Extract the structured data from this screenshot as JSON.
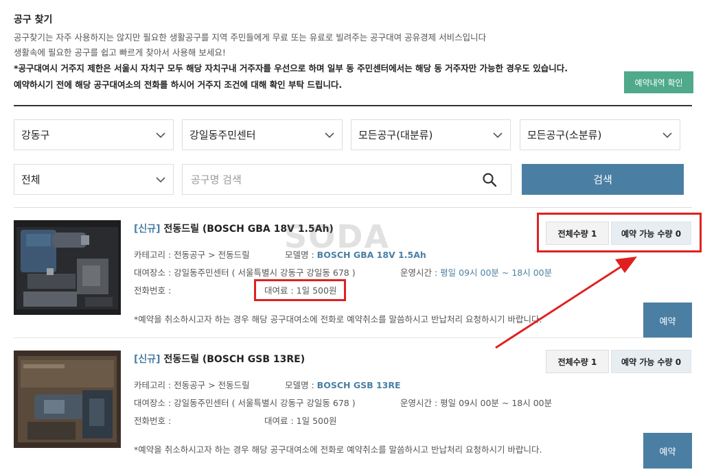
{
  "header": {
    "title": "공구 찾기",
    "desc1": "공구찾기는 자주 사용하지는 않지만 필요한 생활공구를 지역 주민들에게 무료 또는 유료로 빌려주는 공구대여 공유경제 서비스입니다",
    "desc2": "생활속에 필요한 공구를 쉽고 빠르게 찾아서 사용해 보세요!",
    "notice1": "*공구대여시 거주지 제한은 서울시 자치구 모두 해당 자치구내 거주자를 우선으로 하며 일부 동 주민센터에서는 해당 동 거주자만 가능한 경우도 있습니다.",
    "notice2": "예약하시기 전에 해당 공구대여소의 전화를 하시어 거주지 조건에 대해 확인 부탁 드립니다.",
    "reserve_history_label": "예약내역 확인"
  },
  "filters": {
    "district": "강동구",
    "center": "강일동주민센터",
    "category_major": "모든공구(대분류)",
    "category_minor": "모든공구(소분류)",
    "scope": "전체",
    "search_placeholder": "공구명 검색",
    "search_label": "검색"
  },
  "watermark": "SODA",
  "items": [
    {
      "tag": "[신규]",
      "name": "전동드릴 (BOSCH GBA 18V 1.5Ah)",
      "category_label": "카테고리 : 전동공구 > 전동드릴",
      "model_prefix": "모델명 :",
      "model": "BOSCH GBA 18V 1.5Ah",
      "location": "대여장소 : 강일동주민센터 ( 서울특별시 강동구 강일동 678 )",
      "hours_prefix": "운영시간 :",
      "hours": "평일 09시 00분 ~ 18시 00분",
      "phone_label": "전화번호 :",
      "fee": "대여료 : 1일 500원",
      "total_qty": "전체수량 1",
      "avail_qty": "예약 가능 수량 0",
      "note": "*예약을 취소하시고자 하는 경우 해당 공구대여소에 전화로 예약취소를 말씀하시고 반납처리 요청하시기 바랍니다.",
      "reserve_label": "예약"
    },
    {
      "tag": "[신규]",
      "name": "전동드릴 (BOSCH GSB 13RE)",
      "category_label": "카테고리 : 전동공구 > 전동드릴",
      "model_prefix": "모델명 :",
      "model": "BOSCH GSB 13RE",
      "location": "대여장소 : 강일동주민센터 ( 서울특별시 강동구 강일동 678 )",
      "hours_prefix": "운영시간 :",
      "hours": "평일 09시 00분 ~ 18시 00분",
      "phone_label": "전화번호 :",
      "fee": "대여료 : 1일 500원",
      "total_qty": "전체수량 1",
      "avail_qty": "예약 가능 수량 0",
      "note": "*예약을 취소하시고자 하는 경우 해당 공구대여소에 전화로 예약취소를 말씀하시고 반납처리 요청하시기 바랍니다.",
      "reserve_label": "예약"
    }
  ],
  "colors": {
    "accent": "#4a7fa3",
    "green": "#4fa98b",
    "annotation_red": "#e02020"
  }
}
